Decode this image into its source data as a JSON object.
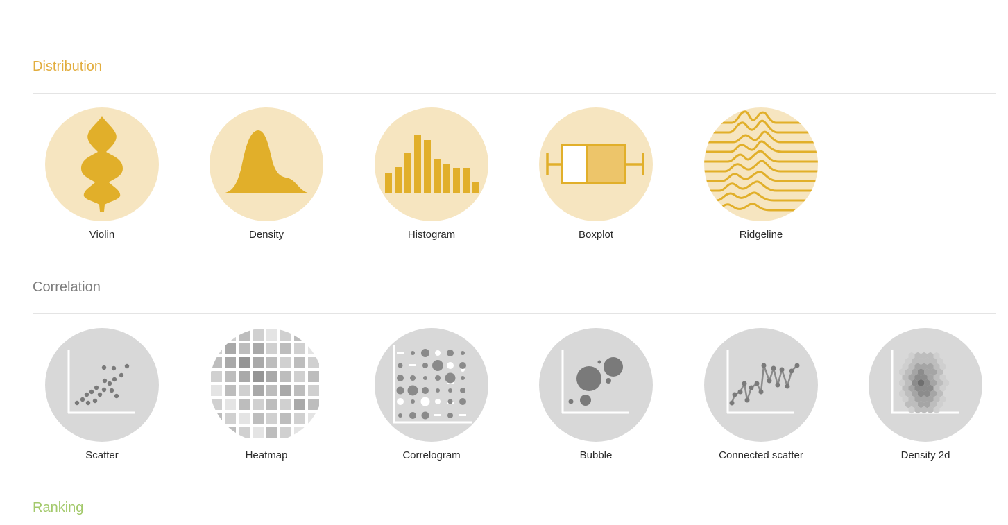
{
  "sections": [
    {
      "title": "Distribution",
      "color": "#e2ad3e",
      "items": [
        {
          "label": "Violin",
          "icon": "violin-icon"
        },
        {
          "label": "Density",
          "icon": "density-icon"
        },
        {
          "label": "Histogram",
          "icon": "histogram-icon"
        },
        {
          "label": "Boxplot",
          "icon": "boxplot-icon"
        },
        {
          "label": "Ridgeline",
          "icon": "ridgeline-icon"
        }
      ]
    },
    {
      "title": "Correlation",
      "color": "#7d7d7d",
      "items": [
        {
          "label": "Scatter",
          "icon": "scatter-icon"
        },
        {
          "label": "Heatmap",
          "icon": "heatmap-icon"
        },
        {
          "label": "Correlogram",
          "icon": "correlogram-icon"
        },
        {
          "label": "Bubble",
          "icon": "bubble-icon"
        },
        {
          "label": "Connected scatter",
          "icon": "connected-scatter-icon"
        },
        {
          "label": "Density 2d",
          "icon": "density-2d-icon"
        }
      ]
    },
    {
      "title": "Ranking",
      "color": "#a3c96b",
      "items": []
    }
  ],
  "colors": {
    "distribution_bg": "#f6e5c0",
    "distribution_fg": "#e1af2a",
    "correlation_bg": "#d8d8d8",
    "correlation_fg": "#8a8a8a"
  }
}
